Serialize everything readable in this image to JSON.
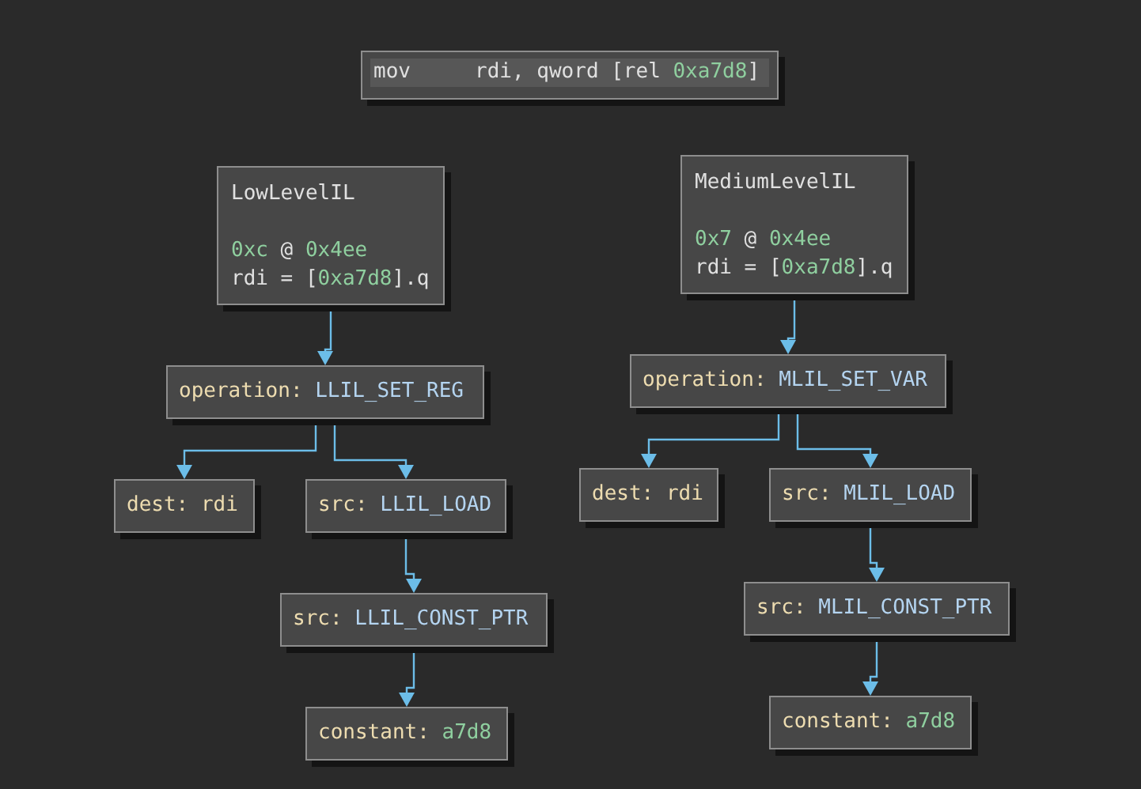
{
  "instruction": {
    "mnemonic": "mov",
    "tokens": [
      {
        "text": "rdi, qword [rel ",
        "kind": "plain"
      },
      {
        "text": "0xa7d8",
        "kind": "number"
      },
      {
        "text": "]",
        "kind": "plain"
      }
    ]
  },
  "graphs": [
    {
      "title": "LowLevelIL",
      "lines": [
        [
          {
            "text": "0xc",
            "kind": "number"
          },
          {
            "text": " @ ",
            "kind": "plain"
          },
          {
            "text": "0x4ee",
            "kind": "number"
          }
        ],
        [
          {
            "text": "rdi = [",
            "kind": "plain"
          },
          {
            "text": "0xa7d8",
            "kind": "number"
          },
          {
            "text": "].q",
            "kind": "plain"
          }
        ]
      ],
      "tree": {
        "tokens": [
          {
            "text": "operation: ",
            "kind": "field"
          },
          {
            "text": "LLIL_SET_REG",
            "kind": "enum"
          }
        ],
        "children": [
          {
            "tokens": [
              {
                "text": "dest: rdi",
                "kind": "field"
              }
            ]
          },
          {
            "tokens": [
              {
                "text": "src: ",
                "kind": "field"
              },
              {
                "text": "LLIL_LOAD",
                "kind": "enum"
              }
            ],
            "children": [
              {
                "tokens": [
                  {
                    "text": "src: ",
                    "kind": "field"
                  },
                  {
                    "text": "LLIL_CONST_PTR",
                    "kind": "enum"
                  }
                ],
                "children": [
                  {
                    "tokens": [
                      {
                        "text": "constant: ",
                        "kind": "field"
                      },
                      {
                        "text": "a7d8",
                        "kind": "number"
                      }
                    ]
                  }
                ]
              }
            ]
          }
        ]
      }
    },
    {
      "title": "MediumLevelIL",
      "lines": [
        [
          {
            "text": "0x7",
            "kind": "number"
          },
          {
            "text": " @ ",
            "kind": "plain"
          },
          {
            "text": "0x4ee",
            "kind": "number"
          }
        ],
        [
          {
            "text": "rdi = [",
            "kind": "plain"
          },
          {
            "text": "0xa7d8",
            "kind": "number"
          },
          {
            "text": "].q",
            "kind": "plain"
          }
        ]
      ],
      "tree": {
        "tokens": [
          {
            "text": "operation: ",
            "kind": "field"
          },
          {
            "text": "MLIL_SET_VAR",
            "kind": "enum"
          }
        ],
        "children": [
          {
            "tokens": [
              {
                "text": "dest: rdi",
                "kind": "field"
              }
            ]
          },
          {
            "tokens": [
              {
                "text": "src: ",
                "kind": "field"
              },
              {
                "text": "MLIL_LOAD",
                "kind": "enum"
              }
            ],
            "children": [
              {
                "tokens": [
                  {
                    "text": "src: ",
                    "kind": "field"
                  },
                  {
                    "text": "MLIL_CONST_PTR",
                    "kind": "enum"
                  }
                ],
                "children": [
                  {
                    "tokens": [
                      {
                        "text": "constant: ",
                        "kind": "field"
                      },
                      {
                        "text": "a7d8",
                        "kind": "number"
                      }
                    ]
                  }
                ]
              }
            ]
          }
        ]
      }
    }
  ]
}
